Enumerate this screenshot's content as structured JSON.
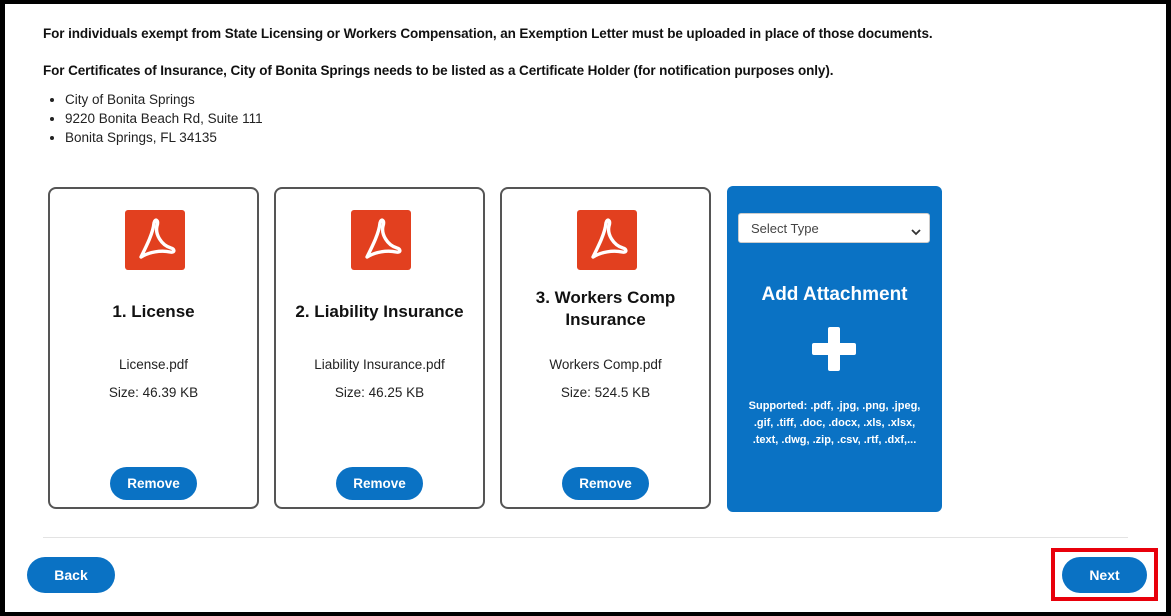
{
  "notices": [
    "For individuals exempt from State Licensing or Workers Compensation, an Exemption Letter must be uploaded in place of those documents.",
    "For Certificates of Insurance, City of Bonita Springs needs to be listed as a Certificate Holder (for notification purposes only)."
  ],
  "address": [
    "City of Bonita Springs",
    "9220 Bonita Beach Rd, Suite 111",
    "Bonita Springs, FL 34135"
  ],
  "attachments": [
    {
      "title": "1. License",
      "file": "License.pdf",
      "size": "Size: 46.39 KB",
      "remove_label": "Remove",
      "icon": "pdf-icon"
    },
    {
      "title": "2. Liability Insurance",
      "file": "Liability Insurance.pdf",
      "size": "Size: 46.25 KB",
      "remove_label": "Remove",
      "icon": "pdf-icon"
    },
    {
      "title": "3. Workers Comp Insurance",
      "file": "Workers Comp.pdf",
      "size": "Size: 524.5 KB",
      "remove_label": "Remove",
      "icon": "pdf-icon"
    }
  ],
  "add_attachment": {
    "select_value": "Select Type",
    "title": "Add Attachment",
    "supported": "Supported: .pdf, .jpg, .png, .jpeg, .gif, .tiff, .doc, .docx, .xls, .xlsx, .text, .dwg, .zip, .csv, .rtf, .dxf,..."
  },
  "nav": {
    "back_label": "Back",
    "next_label": "Next"
  },
  "colors": {
    "primary": "#0a72c4",
    "pdf_red": "#e2401f",
    "highlight": "#e8000b"
  }
}
